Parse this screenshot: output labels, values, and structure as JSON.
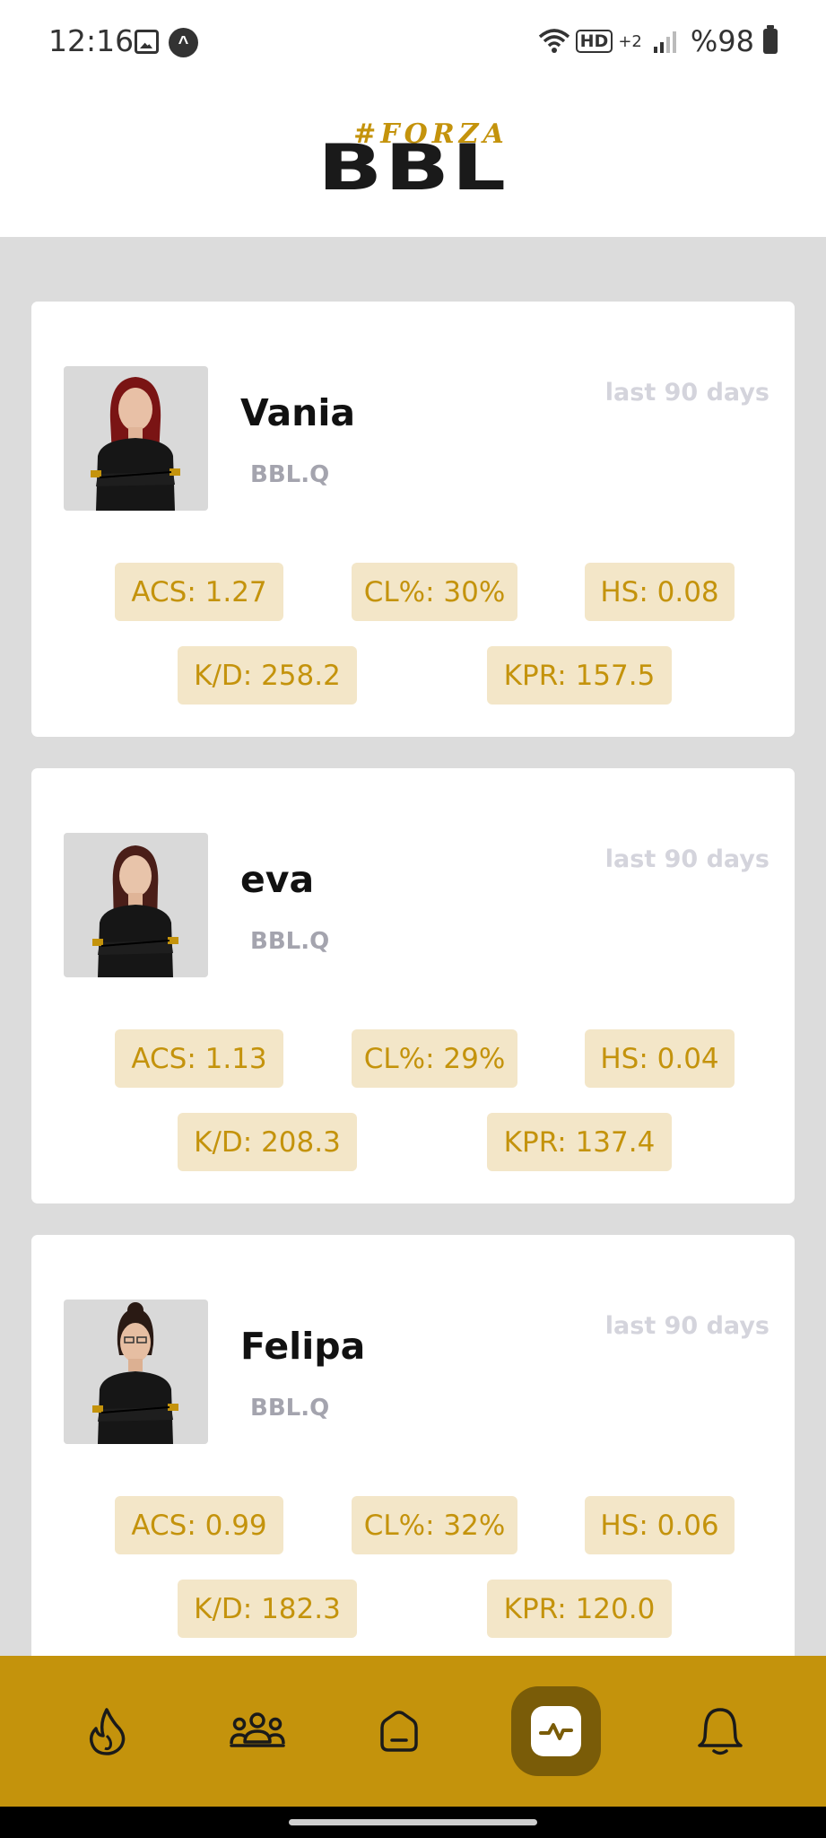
{
  "status_bar": {
    "time": "12:16",
    "network_label": "+2",
    "hd_label": "HD",
    "battery": "%98",
    "icons": [
      "gallery-icon",
      "alert-icon",
      "wifi-icon",
      "signal-icon",
      "battery-icon"
    ]
  },
  "header": {
    "logo_tag": "#FORZA",
    "logo_main": "BBL"
  },
  "colors": {
    "accent": "#c4930c",
    "accent_dark": "#7a5c08",
    "chip_bg": "#f3e6c8",
    "page_bg": "#dcdcdc",
    "team_text": "#a4a4ae",
    "period_text": "#d4d4dc"
  },
  "players": [
    {
      "name": "Vania",
      "team": "BBL.Q",
      "period": "last 90 days",
      "hair": "#7a1414",
      "stats": {
        "acs": "ACS: 1.27",
        "cl": "CL%: 30%",
        "hs": "HS: 0.08",
        "kd": "K/D: 258.2",
        "kpr": "KPR: 157.5"
      }
    },
    {
      "name": "eva",
      "team": "BBL.Q",
      "period": "last 90 days",
      "hair": "#4a1e18",
      "stats": {
        "acs": "ACS: 1.13",
        "cl": "CL%: 29%",
        "hs": "HS: 0.04",
        "kd": "K/D: 208.3",
        "kpr": "KPR: 137.4"
      }
    },
    {
      "name": "Felipa",
      "team": "BBL.Q",
      "period": "last 90 days",
      "hair": "#2a1a14",
      "stats": {
        "acs": "ACS: 0.99",
        "cl": "CL%: 32%",
        "hs": "HS: 0.06",
        "kd": "K/D: 182.3",
        "kpr": "KPR: 120.0"
      }
    }
  ],
  "bottom_nav": {
    "items": [
      {
        "icon": "flame-icon",
        "active": false
      },
      {
        "icon": "team-icon",
        "active": false
      },
      {
        "icon": "home-icon",
        "active": false
      },
      {
        "icon": "activity-icon",
        "active": true
      },
      {
        "icon": "bell-icon",
        "active": false
      }
    ]
  }
}
